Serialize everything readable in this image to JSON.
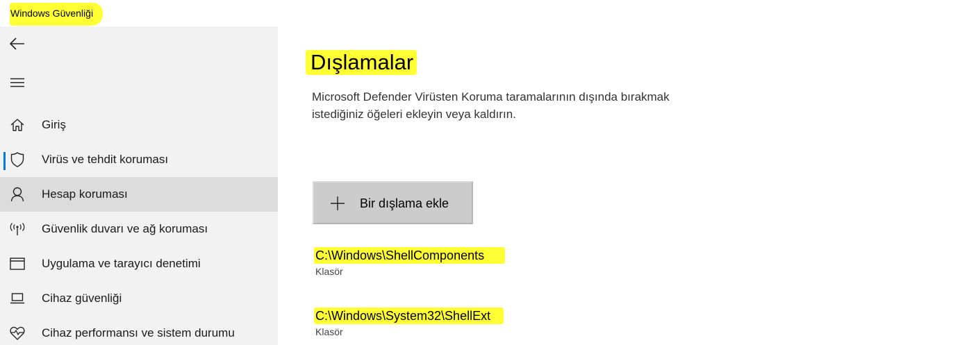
{
  "app": {
    "title": "Windows Güvenliği"
  },
  "sidebar": {
    "back_icon": "back-arrow-icon",
    "menu_icon": "hamburger-menu-icon",
    "items": [
      {
        "label": "Giriş",
        "icon": "home-icon",
        "selected": false,
        "active": false
      },
      {
        "label": "Virüs ve tehdit koruması",
        "icon": "shield-icon",
        "selected": false,
        "active": true
      },
      {
        "label": "Hesap koruması",
        "icon": "person-icon",
        "selected": true,
        "active": false
      },
      {
        "label": "Güvenlik duvarı ve ağ koruması",
        "icon": "antenna-icon",
        "selected": false,
        "active": false
      },
      {
        "label": "Uygulama ve tarayıcı denetimi",
        "icon": "browser-window-icon",
        "selected": false,
        "active": false
      },
      {
        "label": "Cihaz güvenliği",
        "icon": "laptop-icon",
        "selected": false,
        "active": false
      },
      {
        "label": "Cihaz performansı ve sistem durumu",
        "icon": "heart-pulse-icon",
        "selected": false,
        "active": false
      }
    ]
  },
  "main": {
    "title": "Dışlamalar",
    "description_line1": "Microsoft Defender Virüsten Koruma taramalarının dışında bırakmak",
    "description_line2": "istediğiniz öğeleri ekleyin veya kaldırın.",
    "add_button": {
      "label": "Bir dışlama ekle",
      "icon": "plus-icon"
    },
    "exclusions": [
      {
        "path": "C:\\Windows\\ShellComponents",
        "type": "Klasör"
      },
      {
        "path": "C:\\Windows\\System32\\ShellExt",
        "type": "Klasör"
      }
    ]
  },
  "colors": {
    "highlight": "#ffff33",
    "sidebar_bg": "#f2f2f2",
    "selected_bg": "#dcdcdc",
    "accent": "#0078d4",
    "button_bg": "#cccccc"
  }
}
